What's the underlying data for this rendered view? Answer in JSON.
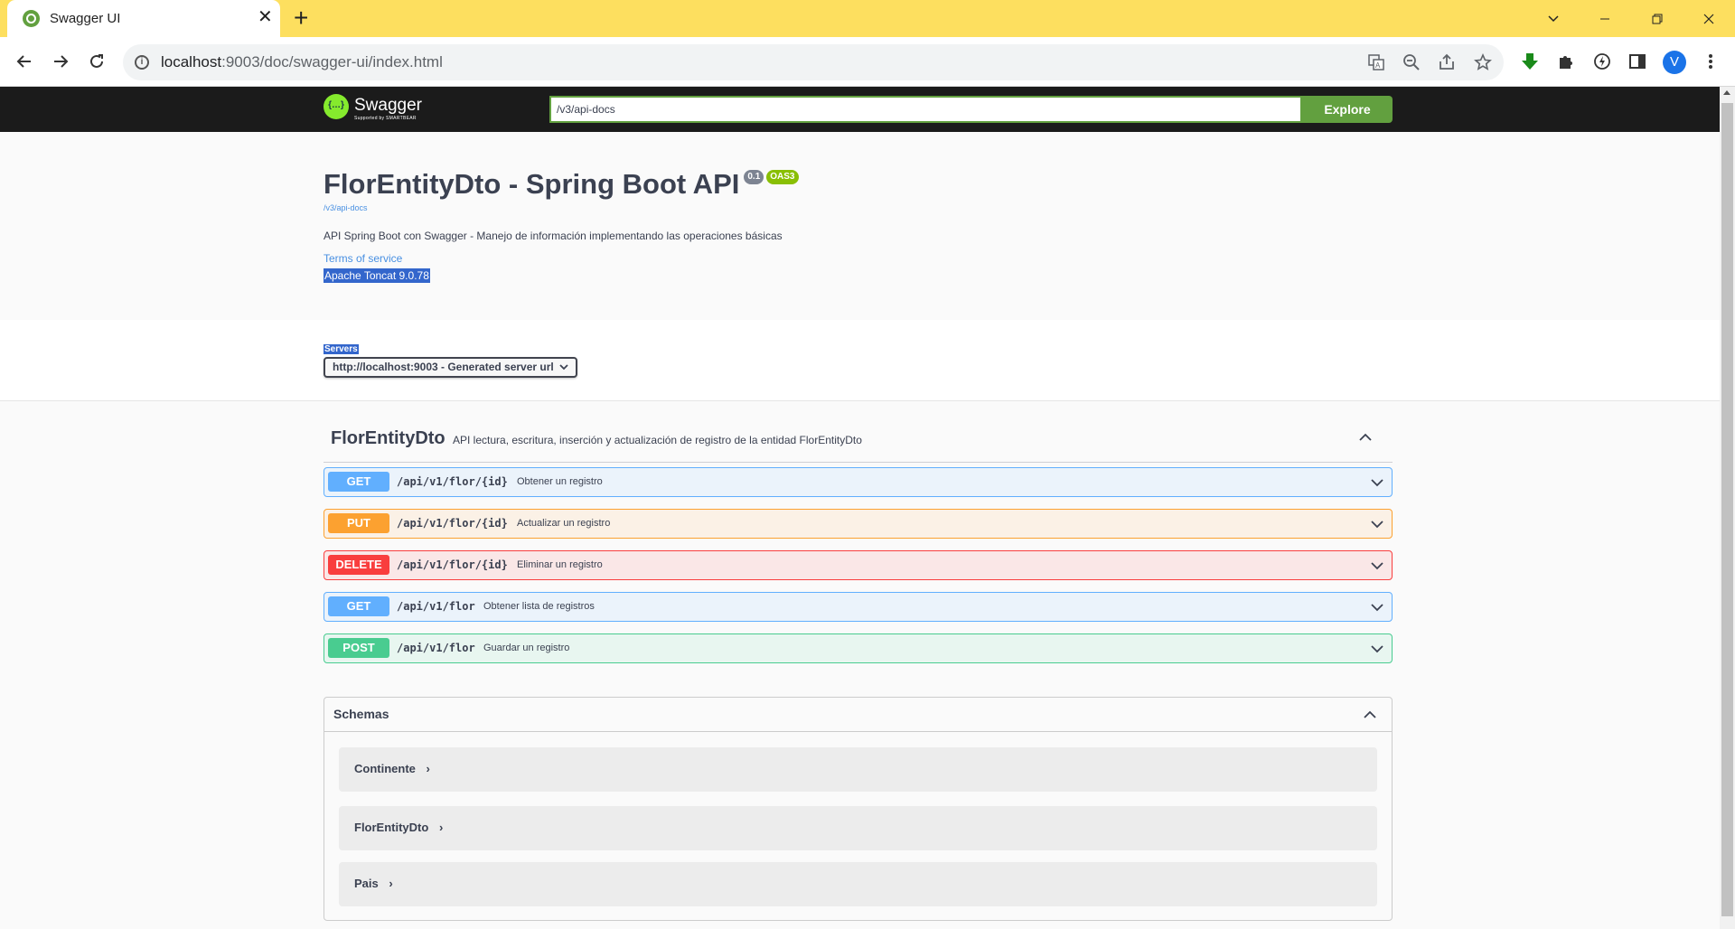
{
  "browser": {
    "tab_title": "Swagger UI",
    "tab_close": "✕",
    "new_tab": "+",
    "window_controls": {
      "minimize": "—",
      "restore": "❐",
      "close": "✕",
      "tab_search": "⌄"
    },
    "url_host": "localhost",
    "url_rest": ":9003/doc/swagger-ui/index.html",
    "avatar_letter": "V",
    "icons": [
      "back-icon",
      "forward-icon",
      "reload-icon",
      "info-icon",
      "translate-icon",
      "zoom-out-icon",
      "share-icon",
      "star-icon",
      "download-icon",
      "extensions-icon",
      "extension-icon",
      "side-panel-icon",
      "menu-icon"
    ]
  },
  "swagger": {
    "topbar": {
      "logo_text": "Swagger",
      "logo_sub": "Supported by SMARTBEAR",
      "url_value": "/v3/api-docs",
      "explore_label": "Explore"
    },
    "info": {
      "title": "FlorEntityDto - Spring Boot API",
      "version": "0.1",
      "oas": "OAS3",
      "spec_link": "/v3/api-docs",
      "description": "API Spring Boot con Swagger - Manejo de información implementando las operaciones básicas",
      "terms": "Terms of service",
      "license": "Apache Toncat 9.0.78"
    },
    "servers": {
      "label": "Servers",
      "selected": "http://localhost:9003 - Generated server url"
    },
    "tag": {
      "name": "FlorEntityDto",
      "description": "API lectura, escritura, inserción y actualización de registro de la entidad FlorEntityDto"
    },
    "operations": [
      {
        "method": "GET",
        "path": "/api/v1/flor/{id}",
        "summary": "Obtener un registro"
      },
      {
        "method": "PUT",
        "path": "/api/v1/flor/{id}",
        "summary": "Actualizar un registro"
      },
      {
        "method": "DELETE",
        "path": "/api/v1/flor/{id}",
        "summary": "Eliminar un registro"
      },
      {
        "method": "GET",
        "path": "/api/v1/flor",
        "summary": "Obtener lista de registros"
      },
      {
        "method": "POST",
        "path": "/api/v1/flor",
        "summary": "Guardar un registro"
      }
    ],
    "schemas": {
      "title": "Schemas",
      "models": [
        "Continente",
        "FlorEntityDto",
        "Pais"
      ],
      "expand_glyph": "›"
    },
    "colors": {
      "get": "#61affe",
      "put": "#fca130",
      "delete": "#f93e3e",
      "post": "#49cc90",
      "explore": "#62a03f"
    }
  }
}
